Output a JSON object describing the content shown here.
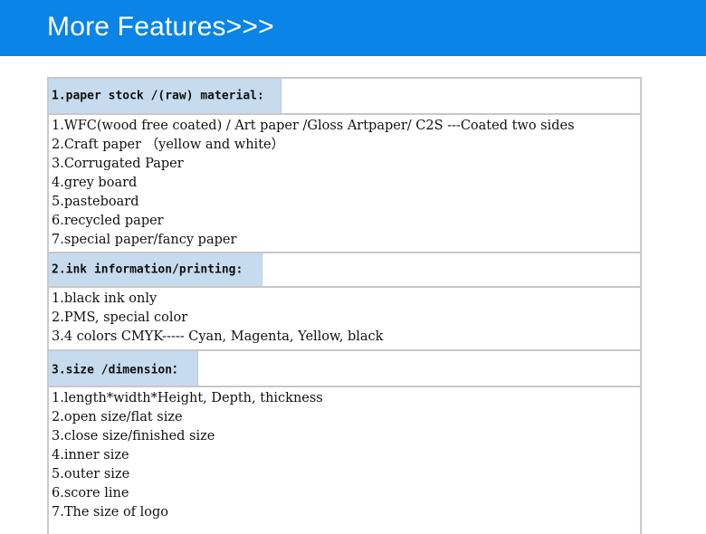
{
  "banner": {
    "title": "More Features>>>"
  },
  "sections": [
    {
      "heading": "1.paper stock /(raw) material:",
      "items": [
        "1.WFC(wood free coated) / Art paper /Gloss Artpaper/ C2S ---Coated two sides",
        "2.Craft paper （yellow and white）",
        "3.Corrugated Paper",
        "4.grey board",
        "5.pasteboard",
        "6.recycled paper",
        "7.special paper/fancy paper"
      ]
    },
    {
      "heading": "2.ink information/printing:",
      "items": [
        "1.black ink only",
        "2.PMS, special color",
        "3.4 colors CMYK----- Cyan, Magenta, Yellow, black"
      ]
    },
    {
      "heading": "3.size /dimension：",
      "items": [
        "1.length*width*Height, Depth, thickness",
        "2.open size/flat size",
        "3.close size/finished size",
        "4.inner size",
        "5.outer size",
        "6.score line",
        "7.The size of logo"
      ]
    }
  ]
}
